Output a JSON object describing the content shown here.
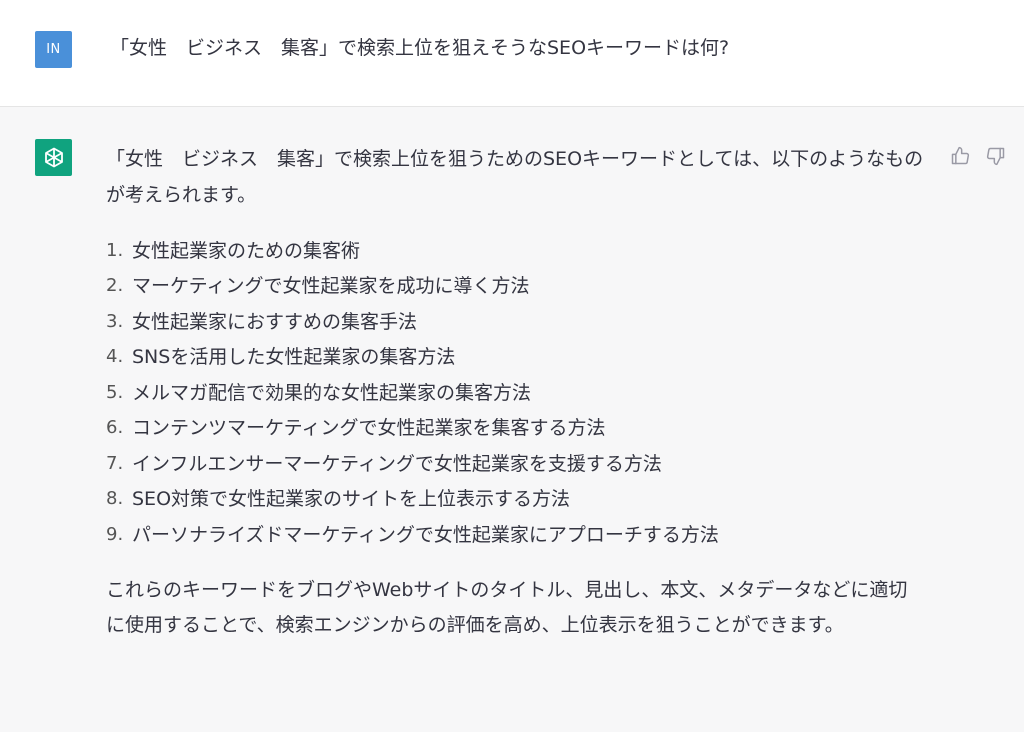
{
  "user": {
    "avatar_label": "IN",
    "message": "「女性　ビジネス　集客」で検索上位を狙えそうなSEOキーワードは何?"
  },
  "assistant": {
    "intro": "「女性　ビジネス　集客」で検索上位を狙うためのSEOキーワードとしては、以下のようなものが考えられます。",
    "list": [
      {
        "num": "1.",
        "text": "女性起業家のための集客術"
      },
      {
        "num": "2.",
        "text": "マーケティングで女性起業家を成功に導く方法"
      },
      {
        "num": "3.",
        "text": "女性起業家におすすめの集客手法"
      },
      {
        "num": "4.",
        "text": "SNSを活用した女性起業家の集客方法"
      },
      {
        "num": "5.",
        "text": "メルマガ配信で効果的な女性起業家の集客方法"
      },
      {
        "num": "6.",
        "text": "コンテンツマーケティングで女性起業家を集客する方法"
      },
      {
        "num": "7.",
        "text": "インフルエンサーマーケティングで女性起業家を支援する方法"
      },
      {
        "num": "8.",
        "text": "SEO対策で女性起業家のサイトを上位表示する方法"
      },
      {
        "num": "9.",
        "text": "パーソナライズドマーケティングで女性起業家にアプローチする方法"
      }
    ],
    "outro": "これらのキーワードをブログやWebサイトのタイトル、見出し、本文、メタデータなどに適切に使用することで、検索エンジンからの評価を高め、上位表示を狙うことができます。"
  },
  "icons": {
    "bot_avatar": "openai-logo-icon",
    "thumbs_up": "thumbs-up-icon",
    "thumbs_down": "thumbs-down-icon"
  },
  "colors": {
    "user_avatar_bg": "#4a90d9",
    "bot_avatar_bg": "#10a37f",
    "assistant_bg": "#f7f7f8"
  }
}
